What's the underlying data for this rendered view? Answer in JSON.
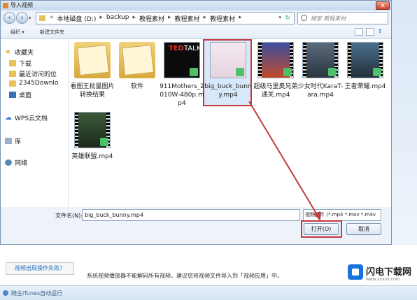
{
  "dialog": {
    "title": "导入视频",
    "close": "✕"
  },
  "address": {
    "crumbs": [
      "本地磁盘 (D:)",
      "backup",
      "教程素材",
      "教程素材",
      "教程素材"
    ],
    "search_placeholder": "搜索 教程素材"
  },
  "toolbar": {
    "organize": "组织 ▾",
    "new_folder": "新建文件夹"
  },
  "sidebar": {
    "favorites": "收藏夹",
    "downloads": "下载",
    "recent": "最近访问的位",
    "folder_2345": "2345Downlo",
    "desktop": "桌面",
    "wps": "WPS云文档",
    "libraries": "库",
    "network": "网络"
  },
  "files": [
    {
      "label": "看图王批量图片转换结果",
      "kind": "folder"
    },
    {
      "label": "软件",
      "kind": "folder"
    },
    {
      "label": "911Mothers_2010W-480p.mp4",
      "kind": "video",
      "thumb_text": "TED",
      "thumb_text2": "TALKS"
    },
    {
      "label": "big_buck_bunny.mp4",
      "kind": "video",
      "selected": true
    },
    {
      "label": "超级马里奥兄弟通关.mp4",
      "kind": "video"
    },
    {
      "label": "少女时代KaraT-ara.mp4",
      "kind": "video"
    },
    {
      "label": "王者荣耀.mp4",
      "kind": "video"
    },
    {
      "label": "英雄联盟.mp4",
      "kind": "video"
    }
  ],
  "bottom": {
    "filename_label": "文件名(N):",
    "filename_value": "big_buck_bunny.mp4",
    "filetype": "视频文件 (*.mp4 *.mov *.m4v",
    "open": "打开(O)",
    "cancel": "取消"
  },
  "background": {
    "hint_link": "视频出现操作失败？",
    "message": "系统视频播放器不能解码所有视频，建议您将视频文件导入到「视频应用」中。",
    "footer": "随主iTunes自动运行"
  },
  "logo": {
    "name": "闪电下载网",
    "url": "www.xxxxx.com"
  },
  "colors": {
    "highlight": "#c23c3c",
    "accent": "#1a73d9"
  }
}
